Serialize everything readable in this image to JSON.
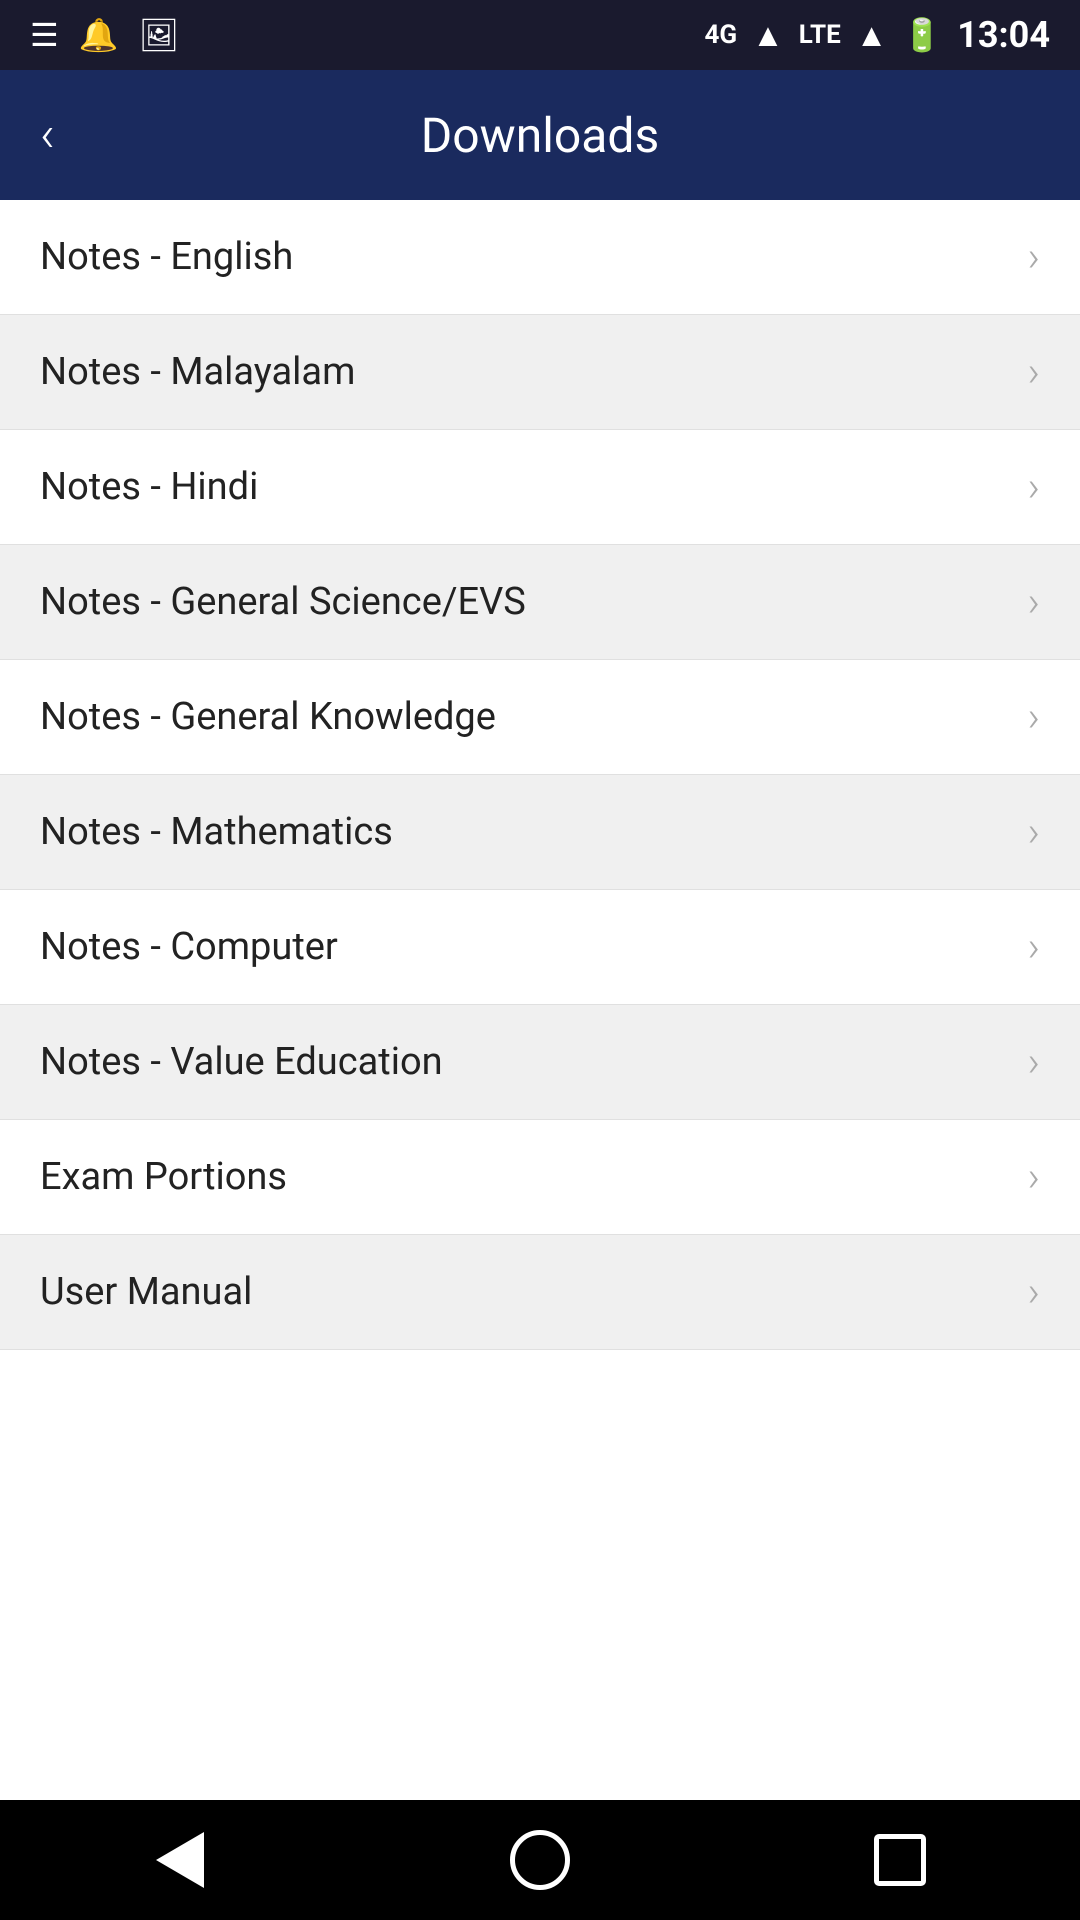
{
  "statusBar": {
    "time": "13:04",
    "network": "4G",
    "networkType": "LTE"
  },
  "header": {
    "title": "Downloads",
    "backLabel": "‹"
  },
  "listItems": [
    {
      "id": 1,
      "label": "Notes - English"
    },
    {
      "id": 2,
      "label": "Notes - Malayalam"
    },
    {
      "id": 3,
      "label": "Notes - Hindi"
    },
    {
      "id": 4,
      "label": "Notes - General Science/EVS"
    },
    {
      "id": 5,
      "label": "Notes - General Knowledge"
    },
    {
      "id": 6,
      "label": "Notes - Mathematics"
    },
    {
      "id": 7,
      "label": "Notes - Computer"
    },
    {
      "id": 8,
      "label": "Notes - Value Education"
    },
    {
      "id": 9,
      "label": "Exam Portions"
    },
    {
      "id": 10,
      "label": "User Manual"
    }
  ],
  "icons": {
    "back": "‹",
    "chevron": "›"
  }
}
